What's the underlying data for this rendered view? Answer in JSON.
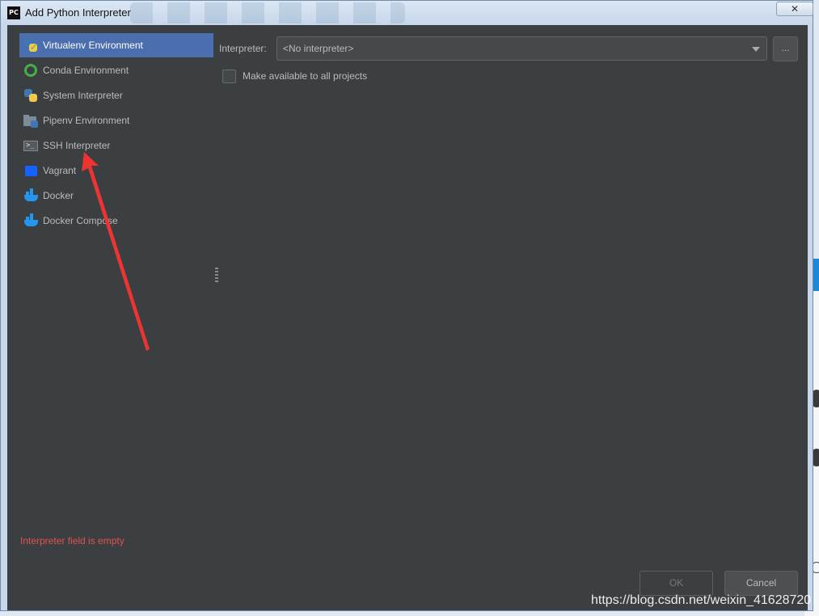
{
  "window": {
    "app_logo_text": "PC",
    "title": "Add Python Interpreter",
    "close_label": "✕"
  },
  "sidebar": {
    "items": [
      {
        "label": "Virtualenv Environment",
        "icon": "python-virtualenv-icon",
        "selected": true
      },
      {
        "label": "Conda Environment",
        "icon": "conda-icon",
        "selected": false
      },
      {
        "label": "System Interpreter",
        "icon": "python-icon",
        "selected": false
      },
      {
        "label": "Pipenv Environment",
        "icon": "pipenv-folder-icon",
        "selected": false
      },
      {
        "label": "SSH Interpreter",
        "icon": "terminal-icon",
        "selected": false
      },
      {
        "label": "Vagrant",
        "icon": "vagrant-icon",
        "selected": false
      },
      {
        "label": "Docker",
        "icon": "docker-icon",
        "selected": false
      },
      {
        "label": "Docker Compose",
        "icon": "docker-compose-icon",
        "selected": false
      }
    ]
  },
  "form": {
    "interpreter_label": "Interpreter:",
    "interpreter_value": "<No interpreter>",
    "browse_label": "...",
    "make_available_label": "Make available to all projects",
    "make_available_checked": false
  },
  "error_message": "Interpreter field is empty",
  "buttons": {
    "ok": "OK",
    "cancel": "Cancel"
  },
  "watermark": "https://blog.csdn.net/weixin_41628720",
  "colors": {
    "background": "#3c3f41",
    "selection": "#4b6eaf",
    "error": "#e0514f",
    "annotation_arrow": "#ee3333"
  }
}
